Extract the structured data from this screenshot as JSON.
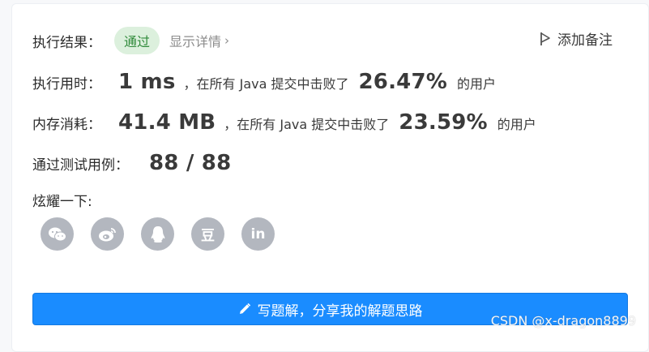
{
  "result": {
    "label": "执行结果：",
    "status": "通过",
    "details_link": "显示详情",
    "details_chevron": "›",
    "add_note": "添加备注"
  },
  "runtime": {
    "label": "执行用时：",
    "value": "1 ms",
    "mid_text": "，在所有 Java 提交中击败了",
    "percent": "26.47%",
    "tail": "的用户"
  },
  "memory": {
    "label": "内存消耗：",
    "value": "41.4 MB",
    "mid_text": "，在所有 Java 提交中击败了",
    "percent": "23.59%",
    "tail": "的用户"
  },
  "tests": {
    "label": "通过测试用例：",
    "value": "88 / 88"
  },
  "share": {
    "label": "炫耀一下:",
    "icons": [
      "wechat-icon",
      "weibo-icon",
      "qq-icon",
      "douban-icon",
      "linkedin-icon"
    ],
    "douban_glyph": "豆",
    "linkedin_glyph": "in"
  },
  "write_button": "写题解，分享我的解题思路",
  "watermark": "CSDN @x-dragon8899",
  "colors": {
    "badge_bg": "#dcf0dd",
    "badge_text": "#2f8a3a",
    "primary": "#1a8cff",
    "icon_gray": "#b3b7bf"
  }
}
